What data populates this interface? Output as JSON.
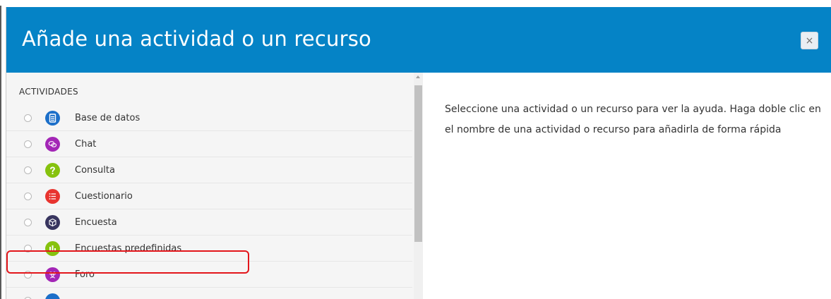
{
  "modal": {
    "title": "Añade una actividad o un recurso",
    "close_label": "×"
  },
  "activities": {
    "section_label": "ACTIVIDADES",
    "items": [
      {
        "label": "Base de datos",
        "icon": "database-icon",
        "color": "#1c6fc9"
      },
      {
        "label": "Chat",
        "icon": "chat-icon",
        "color": "#a326b6"
      },
      {
        "label": "Consulta",
        "icon": "question-icon",
        "color": "#86c20e"
      },
      {
        "label": "Cuestionario",
        "icon": "quiz-list-icon",
        "color": "#e8342f",
        "highlighted": true
      },
      {
        "label": "Encuesta",
        "icon": "survey-cube-icon",
        "color": "#38355f"
      },
      {
        "label": "Encuestas predefinidas",
        "icon": "bar-chart-icon",
        "color": "#86c20e"
      },
      {
        "label": "Foro",
        "icon": "forum-people-icon",
        "color": "#a326b6"
      },
      {
        "label": "",
        "icon": "next-activity-icon",
        "color": "#1c6fc9"
      }
    ]
  },
  "help": {
    "text": "Seleccione una actividad o un recurso para ver la ayuda. Haga doble clic en el nombre de una actividad o recurso para añadirla de forma rápida"
  },
  "colors": {
    "header": "#0583c6",
    "highlight": "#e3161b"
  }
}
